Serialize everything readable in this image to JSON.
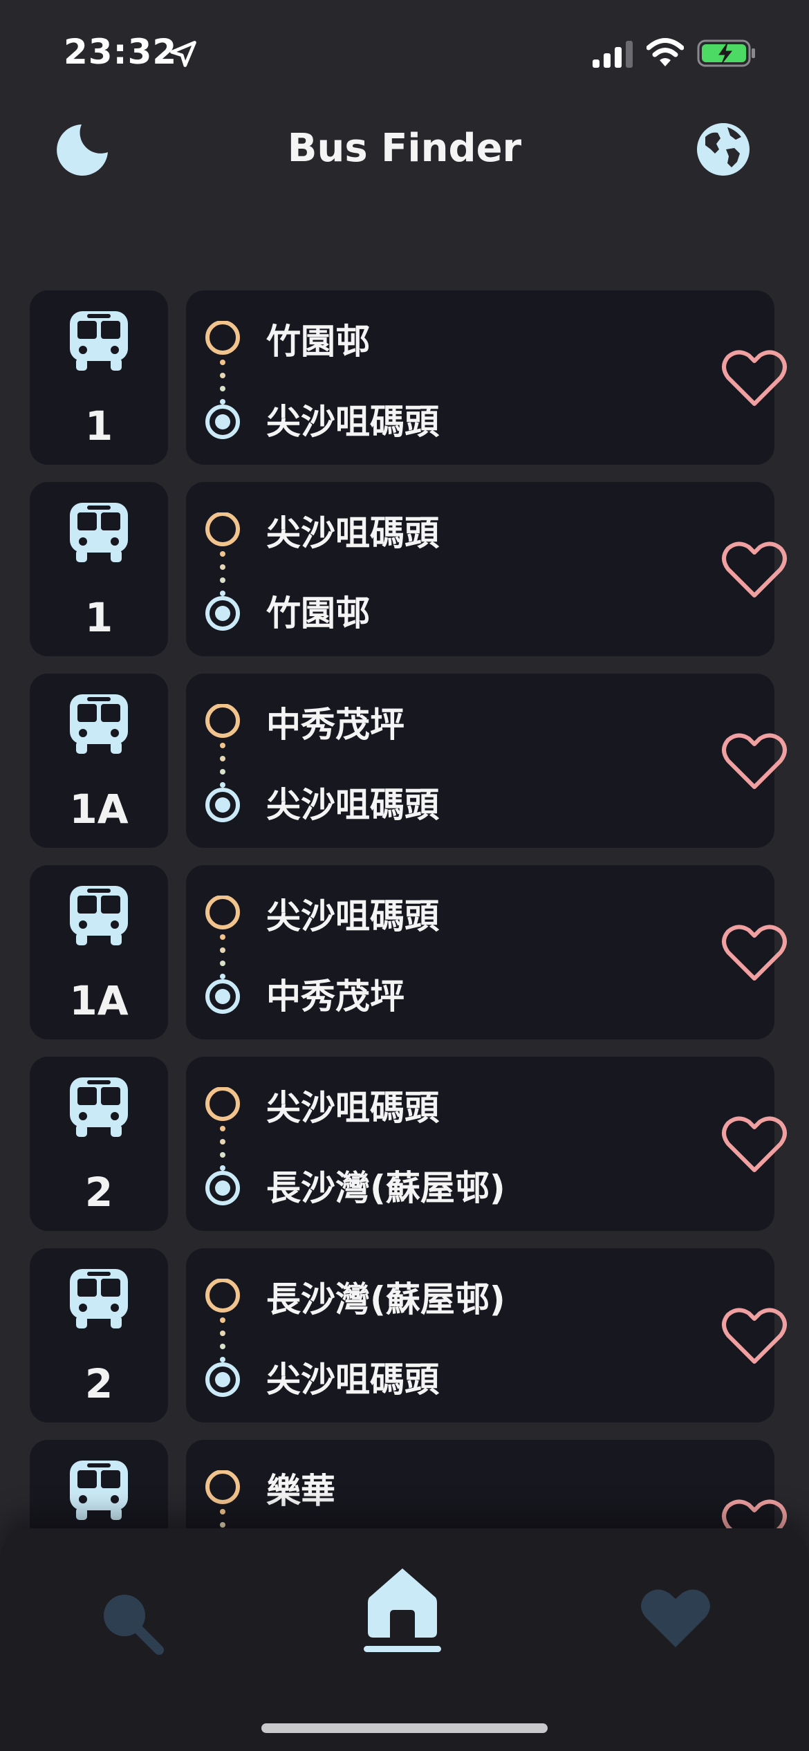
{
  "status_bar": {
    "time": "23:32"
  },
  "header": {
    "title": "Bus Finder"
  },
  "colors": {
    "background": "#27272c",
    "card": "#17171f",
    "accent_blue": "#cbeaf7",
    "origin_orange": "#f2c48d",
    "heart_pink": "#f0a0a0",
    "nav_inactive": "#2f3f52",
    "battery_green": "#4cd964"
  },
  "icons": {
    "theme": "moon-icon",
    "language": "globe-icon",
    "route": "bus-icon",
    "favorite": "heart-outline-icon",
    "nav_search": "search-icon",
    "nav_home": "home-icon",
    "nav_favorites": "heart-filled-icon"
  },
  "routes": [
    {
      "number": "1",
      "origin": "竹園邨",
      "destination": "尖沙咀碼頭"
    },
    {
      "number": "1",
      "origin": "尖沙咀碼頭",
      "destination": "竹園邨"
    },
    {
      "number": "1A",
      "origin": "中秀茂坪",
      "destination": "尖沙咀碼頭"
    },
    {
      "number": "1A",
      "origin": "尖沙咀碼頭",
      "destination": "中秀茂坪"
    },
    {
      "number": "2",
      "origin": "尖沙咀碼頭",
      "destination": "長沙灣(蘇屋邨)"
    },
    {
      "number": "2",
      "origin": "長沙灣(蘇屋邨)",
      "destination": "尖沙咀碼頭"
    },
    {
      "number": "",
      "origin": "樂華",
      "destination": ""
    }
  ],
  "bottom_nav": {
    "active": "home"
  }
}
